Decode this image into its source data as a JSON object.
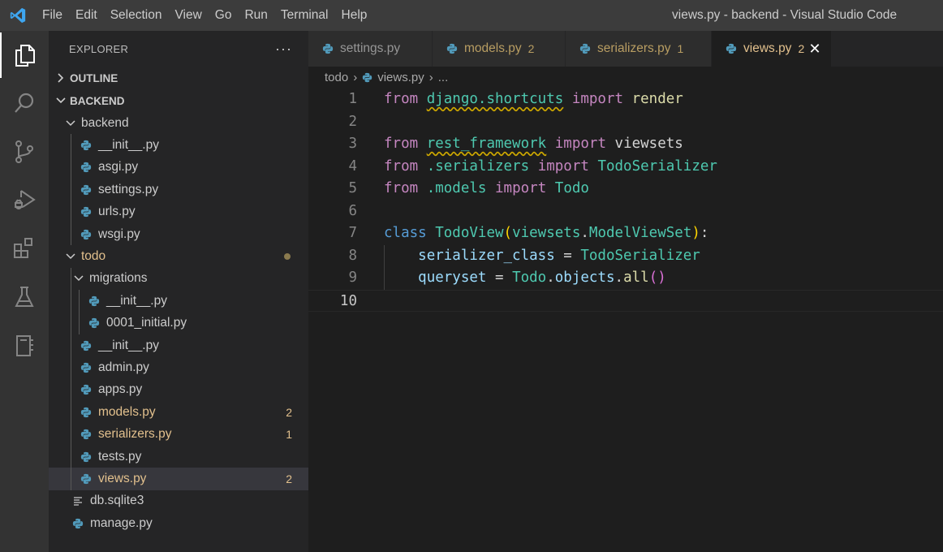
{
  "window": {
    "title": "views.py - backend - Visual Studio Code"
  },
  "menu": [
    "File",
    "Edit",
    "Selection",
    "View",
    "Go",
    "Run",
    "Terminal",
    "Help"
  ],
  "activity": [
    "explorer-icon",
    "search-icon",
    "source-control-icon",
    "run-debug-icon",
    "extensions-icon",
    "testing-icon",
    "notebook-icon"
  ],
  "explorer": {
    "title": "EXPLORER",
    "more": "···",
    "outline": "OUTLINE",
    "project": "BACKEND",
    "tree": [
      {
        "label": "backend",
        "type": "folder",
        "depth": 1
      },
      {
        "label": "__init__.py",
        "type": "py",
        "depth": 2
      },
      {
        "label": "asgi.py",
        "type": "py",
        "depth": 2
      },
      {
        "label": "settings.py",
        "type": "py",
        "depth": 2
      },
      {
        "label": "urls.py",
        "type": "py",
        "depth": 2
      },
      {
        "label": "wsgi.py",
        "type": "py",
        "depth": 2
      },
      {
        "label": "todo",
        "type": "folder",
        "depth": 1,
        "warn": true,
        "dot": true
      },
      {
        "label": "migrations",
        "type": "folder",
        "depth": 2
      },
      {
        "label": "__init__.py",
        "type": "py",
        "depth": 3
      },
      {
        "label": "0001_initial.py",
        "type": "py",
        "depth": 3
      },
      {
        "label": "__init__.py",
        "type": "py",
        "depth": 2
      },
      {
        "label": "admin.py",
        "type": "py",
        "depth": 2
      },
      {
        "label": "apps.py",
        "type": "py",
        "depth": 2
      },
      {
        "label": "models.py",
        "type": "py",
        "depth": 2,
        "warn": true,
        "badge": "2"
      },
      {
        "label": "serializers.py",
        "type": "py",
        "depth": 2,
        "warn": true,
        "badge": "1"
      },
      {
        "label": "tests.py",
        "type": "py",
        "depth": 2
      },
      {
        "label": "views.py",
        "type": "py",
        "depth": 2,
        "warn": true,
        "badge": "2",
        "selected": true
      },
      {
        "label": "db.sqlite3",
        "type": "text",
        "depth": 1
      },
      {
        "label": "manage.py",
        "type": "py",
        "depth": 1
      }
    ]
  },
  "tabs": [
    {
      "label": "settings.py",
      "badge": ""
    },
    {
      "label": "models.py",
      "badge": "2"
    },
    {
      "label": "serializers.py",
      "badge": "1"
    },
    {
      "label": "views.py",
      "badge": "2",
      "active": true
    }
  ],
  "breadcrumb": {
    "folder": "todo",
    "file": "views.py",
    "symbol": "..."
  },
  "editor": {
    "line_numbers": [
      "1",
      "2",
      "3",
      "4",
      "5",
      "6",
      "7",
      "8",
      "9",
      "10"
    ],
    "active_line": "10",
    "lines": [
      [
        [
          "kw",
          "from"
        ],
        [
          "pl",
          " "
        ],
        [
          "mod squig",
          "django.shortcuts"
        ],
        [
          "pl",
          " "
        ],
        [
          "kw",
          "import"
        ],
        [
          "pl",
          " "
        ],
        [
          "fn",
          "render"
        ]
      ],
      [],
      [
        [
          "kw",
          "from"
        ],
        [
          "pl",
          " "
        ],
        [
          "mod squig",
          "rest_framework"
        ],
        [
          "pl",
          " "
        ],
        [
          "kw",
          "import"
        ],
        [
          "pl",
          " "
        ],
        [
          "pl",
          "viewsets"
        ]
      ],
      [
        [
          "kw",
          "from"
        ],
        [
          "pl",
          " "
        ],
        [
          "mod",
          ".serializers"
        ],
        [
          "pl",
          " "
        ],
        [
          "kw",
          "import"
        ],
        [
          "pl",
          " "
        ],
        [
          "cls",
          "TodoSerializer"
        ]
      ],
      [
        [
          "kw",
          "from"
        ],
        [
          "pl",
          " "
        ],
        [
          "mod",
          ".models"
        ],
        [
          "pl",
          " "
        ],
        [
          "kw",
          "import"
        ],
        [
          "pl",
          " "
        ],
        [
          "cls",
          "Todo"
        ]
      ],
      [],
      [
        [
          "kb",
          "class"
        ],
        [
          "pl",
          " "
        ],
        [
          "cls",
          "TodoView"
        ],
        [
          "br",
          "("
        ],
        [
          "mod",
          "viewsets"
        ],
        [
          "pl",
          "."
        ],
        [
          "cls",
          "ModelViewSet"
        ],
        [
          "br",
          ")"
        ],
        [
          "pl",
          ":"
        ]
      ],
      [
        [
          "pl",
          "    "
        ],
        [
          "var",
          "serializer_class"
        ],
        [
          "pl",
          " = "
        ],
        [
          "cls",
          "TodoSerializer"
        ]
      ],
      [
        [
          "pl",
          "    "
        ],
        [
          "var",
          "queryset"
        ],
        [
          "pl",
          " = "
        ],
        [
          "cls",
          "Todo"
        ],
        [
          "pl",
          "."
        ],
        [
          "var",
          "objects"
        ],
        [
          "pl",
          "."
        ],
        [
          "fn",
          "all"
        ],
        [
          "br2",
          "()"
        ]
      ],
      []
    ]
  }
}
